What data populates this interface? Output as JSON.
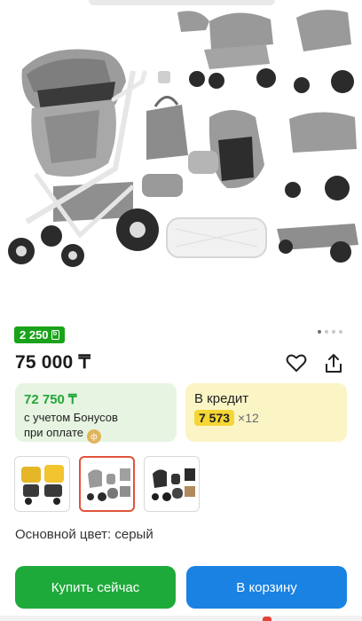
{
  "product": {
    "bonus_badge": "2 250",
    "bonus_badge_icon": "b",
    "price": "75 000 ₸",
    "gallery": {
      "slides_total": 4,
      "active_slide": 1
    },
    "bonus_card": {
      "amount": "72 750 ₸",
      "note_line1": "с учетом Бонусов",
      "note_line2": "при оплате"
    },
    "credit_card": {
      "title": "В кредит",
      "monthly": "7 573",
      "months": "×12"
    },
    "thumbnails": [
      {
        "name": "thumb-yellow-stroller",
        "selected": false
      },
      {
        "name": "thumb-grey-stroller-set",
        "selected": true
      },
      {
        "name": "thumb-black-stroller-set",
        "selected": false
      }
    ],
    "color_label": "Основной цвет: серый"
  },
  "actions": {
    "buy_now": "Купить сейчас",
    "add_to_cart": "В корзину"
  },
  "colors": {
    "green": "#1eaa3a",
    "blue": "#1a82e2",
    "badge_green": "#1aa31a",
    "yellow_pill": "#f5d635"
  },
  "icons": [
    "heart-icon",
    "share-icon",
    "bonus-coin-icon"
  ]
}
